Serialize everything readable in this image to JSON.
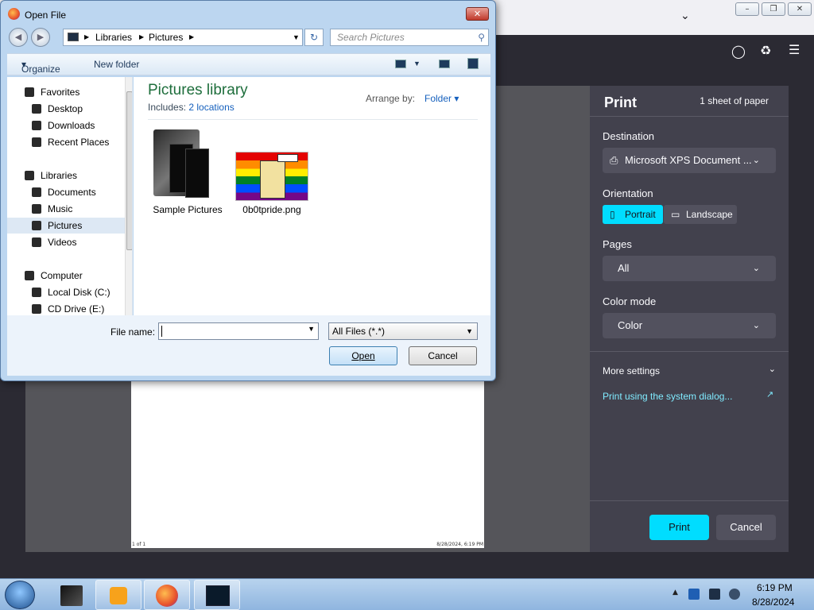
{
  "dialog": {
    "title": "Open File",
    "address": {
      "segments": [
        "Libraries",
        "Pictures"
      ]
    },
    "search_placeholder": "Search Pictures",
    "commandbar": {
      "organize": "Organize",
      "new_folder": "New folder"
    },
    "nav": {
      "favorites": "Favorites",
      "desktop": "Desktop",
      "downloads": "Downloads",
      "recent": "Recent Places",
      "libraries": "Libraries",
      "documents": "Documents",
      "music": "Music",
      "pictures": "Pictures",
      "videos": "Videos",
      "computer": "Computer",
      "local_disk": "Local Disk (C:)",
      "cd_drive": "CD Drive (E:)"
    },
    "library": {
      "title": "Pictures library",
      "includes_label": "Includes:",
      "includes_link": "2 locations",
      "arrange_label": "Arrange by:",
      "arrange_value": "Folder"
    },
    "files": [
      {
        "name": "Sample Pictures"
      },
      {
        "name": "0b0tpride.png"
      }
    ],
    "filename_label": "File name:",
    "filename_value": "",
    "filetype_value": "All Files (*.*)",
    "open_label": "Open",
    "cancel_label": "Cancel"
  },
  "print_panel": {
    "title": "Print",
    "sheets": "1 sheet of paper",
    "destination_label": "Destination",
    "destination_value": "Microsoft XPS Document ...",
    "orientation_label": "Orientation",
    "portrait_label": "Portrait",
    "landscape_label": "Landscape",
    "orientation_selected": "Portrait",
    "pages_label": "Pages",
    "pages_value": "All",
    "color_label": "Color mode",
    "color_value": "Color",
    "more_settings": "More settings",
    "system_dialog": "Print using the system dialog...",
    "print_button": "Print",
    "cancel_button": "Cancel"
  },
  "preview": {
    "footer_left": "1 of 1",
    "footer_right": "8/28/2024, 6:19 PM"
  },
  "taskbar": {
    "time": "6:19 PM",
    "date": "8/28/2024"
  },
  "colors": {
    "accent": "#00ddff",
    "link": "#80ebff",
    "panel": "#42414d",
    "library_title": "#1e6e3c"
  }
}
